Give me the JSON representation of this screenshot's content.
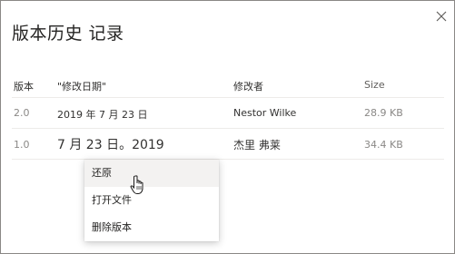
{
  "dialog": {
    "title": "版本历史 记录",
    "close_icon": "close-icon"
  },
  "table": {
    "columns": [
      "版本",
      "\"修改日期\"",
      "修改者",
      "Size"
    ],
    "rows": [
      {
        "version": "2.0",
        "modified": "2019 年 7 月 23 日",
        "modified_by": "Nestor Wilke",
        "size": "28.9 KB"
      },
      {
        "version": "1.0",
        "modified": "7 月 23 日。2019",
        "modified_by": "杰里 弗莱",
        "size": "34.4 KB"
      }
    ]
  },
  "context_menu": {
    "items": [
      "还原",
      "打开文件",
      "删除版本"
    ],
    "hovered_index": 0
  },
  "cursor": {
    "icon": "hand-pointer-icon"
  },
  "colors": {
    "text_primary": "#252423",
    "text_secondary": "#8a8886",
    "divider": "#edebe9",
    "menu_hover": "#f3f2f1",
    "border": "#8a8886"
  }
}
